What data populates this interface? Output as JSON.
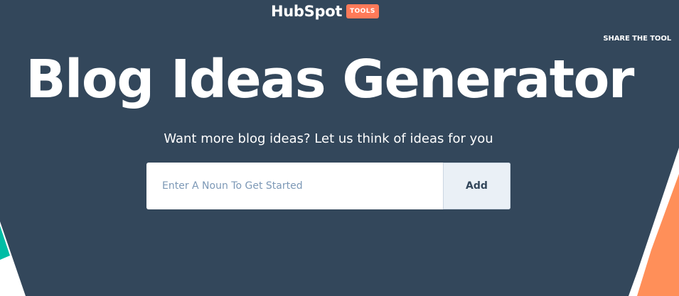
{
  "brand": {
    "logo_text": "HubSpot",
    "badge_text": "TOOLS"
  },
  "header": {
    "share_label": "SHARE THE TOOL"
  },
  "hero": {
    "title": "Blog Ideas Generator",
    "subtitle": "Want more blog ideas? Let us think of ideas for you"
  },
  "form": {
    "noun_placeholder": "Enter A Noun To Get Started",
    "noun_value": "",
    "add_label": "Add"
  },
  "colors": {
    "hero_background": "#33475b",
    "badge": "#ff7a59",
    "accent_left": "#00bda5",
    "accent_right": "#ff8f59"
  }
}
